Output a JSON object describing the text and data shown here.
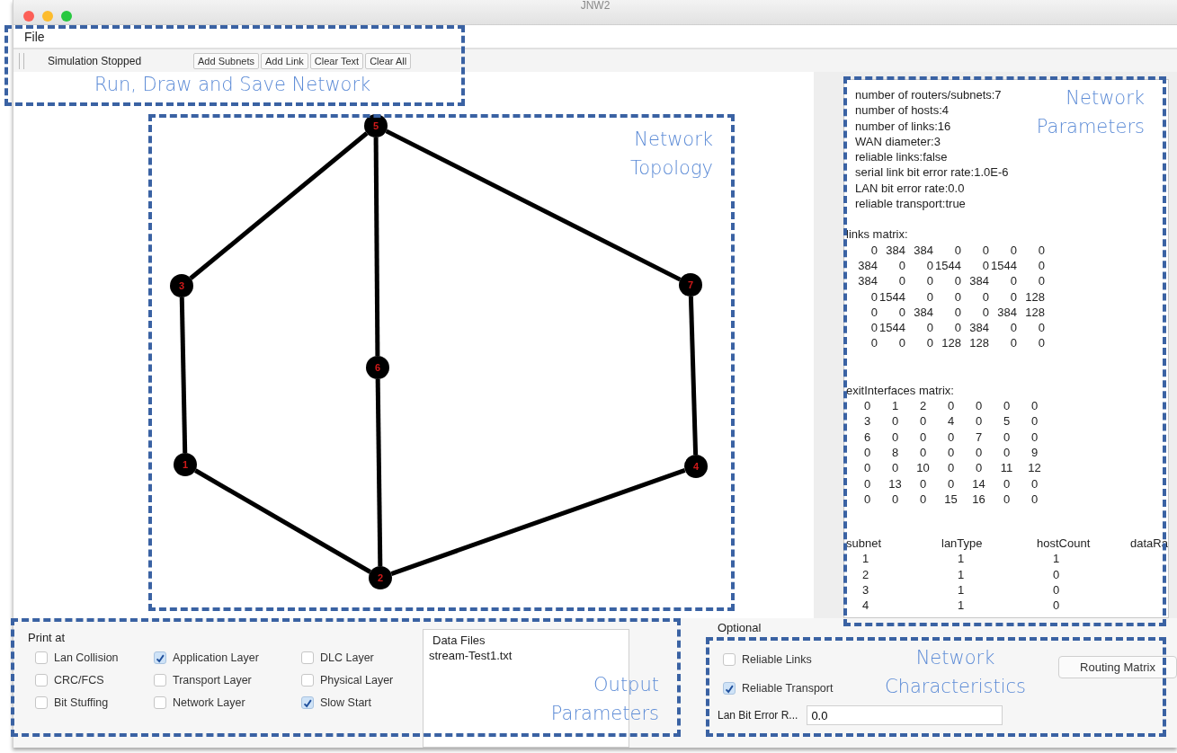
{
  "window": {
    "title": "JNW2"
  },
  "menu_bar": [
    {
      "label": "File"
    }
  ],
  "toolbar": {
    "status": "Simulation Stopped",
    "buttons": [
      "Add Subnets",
      "Add Link",
      "Clear Text",
      "Clear All"
    ]
  },
  "topology": {
    "nodes": [
      {
        "label": "5"
      },
      {
        "label": "3"
      },
      {
        "label": "7"
      },
      {
        "label": "6"
      },
      {
        "label": "1"
      },
      {
        "label": "4"
      },
      {
        "label": "2"
      }
    ]
  },
  "network_parameters": {
    "lines": [
      "number of routers/subnets:7",
      "number of hosts:4",
      "number of links:16",
      "WAN diameter:3",
      "reliable links:false",
      "serial link bit error rate:1.0E-6",
      "LAN bit error rate:0.0",
      "reliable transport:true"
    ],
    "links_matrix": {
      "title": "links matrix:",
      "rows": [
        [
          "0",
          "384",
          "384",
          "0",
          "0",
          "0",
          "0"
        ],
        [
          "384",
          "0",
          "0",
          "1544",
          "0",
          "1544",
          "0"
        ],
        [
          "384",
          "0",
          "0",
          "0",
          "384",
          "0",
          "0"
        ],
        [
          "0",
          "1544",
          "0",
          "0",
          "0",
          "0",
          "128"
        ],
        [
          "0",
          "0",
          "384",
          "0",
          "0",
          "384",
          "128"
        ],
        [
          "0",
          "1544",
          "0",
          "0",
          "384",
          "0",
          "0"
        ],
        [
          "0",
          "0",
          "0",
          "128",
          "128",
          "0",
          "0"
        ]
      ]
    },
    "exit_interfaces_matrix": {
      "title": "exitInterfaces matrix:",
      "rows": [
        [
          "0",
          "1",
          "2",
          "0",
          "0",
          "0",
          "0"
        ],
        [
          "3",
          "0",
          "0",
          "4",
          "0",
          "5",
          "0"
        ],
        [
          "6",
          "0",
          "0",
          "0",
          "7",
          "0",
          "0"
        ],
        [
          "0",
          "8",
          "0",
          "0",
          "0",
          "0",
          "9"
        ],
        [
          "0",
          "0",
          "10",
          "0",
          "0",
          "11",
          "12"
        ],
        [
          "0",
          "13",
          "0",
          "0",
          "14",
          "0",
          "0"
        ],
        [
          "0",
          "0",
          "0",
          "15",
          "16",
          "0",
          "0"
        ]
      ]
    },
    "subnet_table": {
      "columns": [
        "subnet",
        "lanType",
        "hostCount",
        "dataRa"
      ],
      "rows": [
        [
          "1",
          "1",
          "1"
        ],
        [
          "2",
          "1",
          "0"
        ],
        [
          "3",
          "1",
          "0"
        ],
        [
          "4",
          "1",
          "0"
        ]
      ]
    }
  },
  "print_at": {
    "title": "Print at",
    "options": [
      {
        "label": "Lan Collision",
        "checked": false
      },
      {
        "label": "Application Layer",
        "checked": true
      },
      {
        "label": "DLC Layer",
        "checked": false
      },
      {
        "label": "CRC/FCS",
        "checked": false
      },
      {
        "label": "Transport Layer",
        "checked": false
      },
      {
        "label": "Physical Layer",
        "checked": false
      },
      {
        "label": "Bit Stuffing",
        "checked": false
      },
      {
        "label": "Network Layer",
        "checked": false
      },
      {
        "label": "Slow Start",
        "checked": true
      }
    ]
  },
  "data_files": {
    "title": "Data Files",
    "files": [
      "stream-Test1.txt"
    ]
  },
  "optional": {
    "title": "Optional",
    "options": [
      {
        "label": "Reliable Links",
        "checked": false
      },
      {
        "label": "Reliable Transport",
        "checked": true
      }
    ],
    "routing_button": "Routing Matrix",
    "lan_bit_error_rate": {
      "label": "Lan Bit Error R...",
      "value": "0.0"
    }
  },
  "annotations": [
    {
      "label": "Run, Draw and Save Network"
    },
    {
      "label": "Network Topology"
    },
    {
      "label": "Network Parameters"
    },
    {
      "label": "Output Parameters"
    },
    {
      "label": "Network Characteristics"
    }
  ]
}
